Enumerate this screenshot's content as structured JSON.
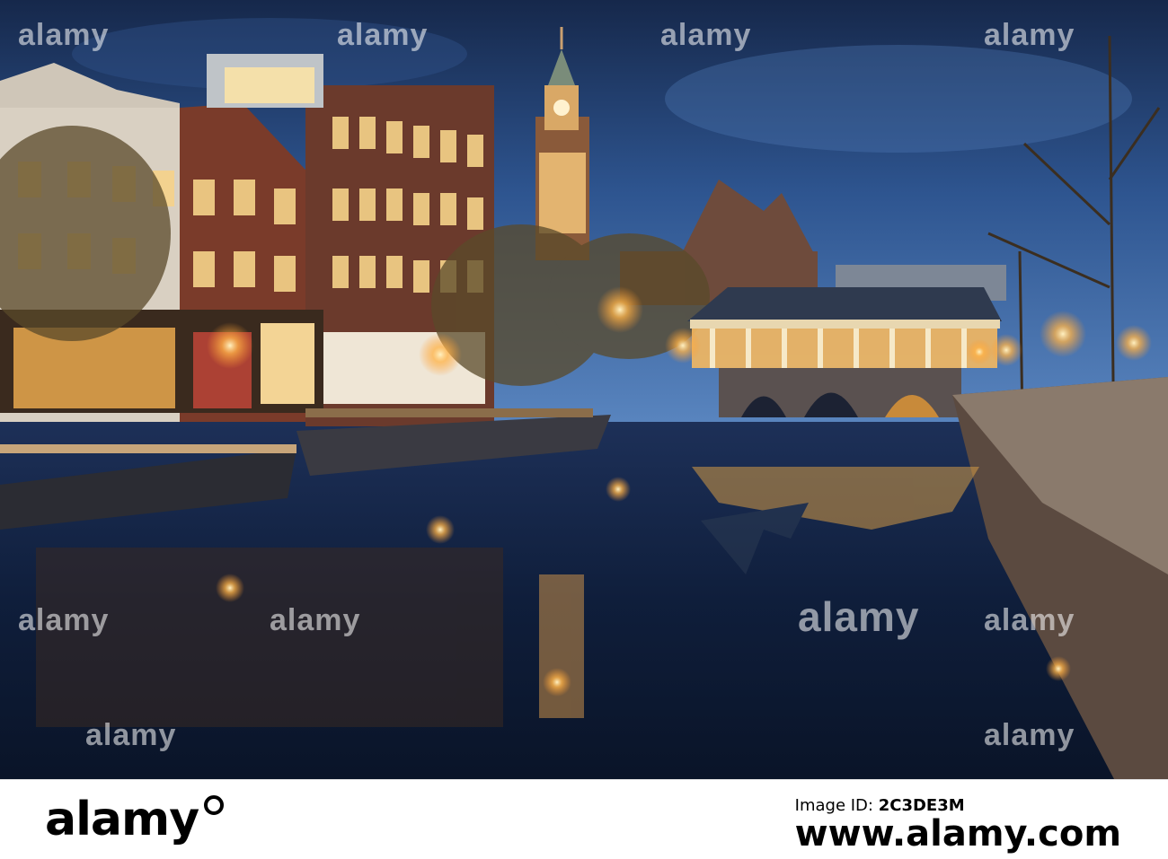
{
  "watermark": {
    "text": "alamy"
  },
  "footer": {
    "logo": "alamy",
    "image_id_label": "Image ID:",
    "image_id": "2C3DE3M",
    "site": "www.alamy.com"
  },
  "colors": {
    "sky_top": "#1d3461",
    "sky_mid": "#3e6aa8",
    "water": "#0e1f3a",
    "lamp": "#ffb347"
  }
}
